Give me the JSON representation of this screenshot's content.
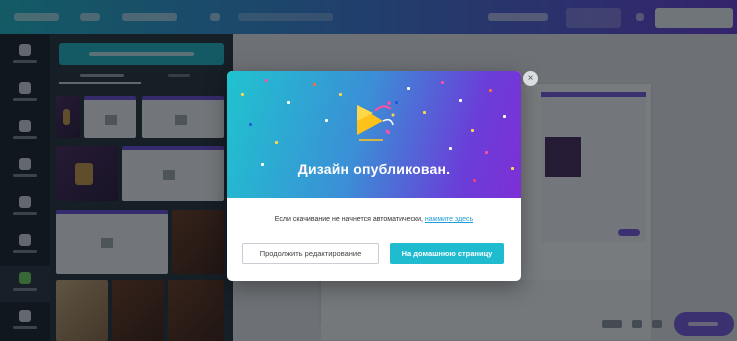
{
  "modal": {
    "title": "Дизайн опубликован.",
    "message_prefix": "Если скачивание не начнется автоматически,",
    "message_link": "нажмите здесь",
    "continue_label": "Продолжить редактирование",
    "home_label": "На домашнюю страницу",
    "close_glyph": "×"
  },
  "colors": {
    "accent": "#1fbccf",
    "hero_start": "#1fc3cf",
    "hero_end": "#7d2fd6",
    "link": "#1f9fd6"
  },
  "icons": [
    "party-popper-icon",
    "close-icon"
  ]
}
